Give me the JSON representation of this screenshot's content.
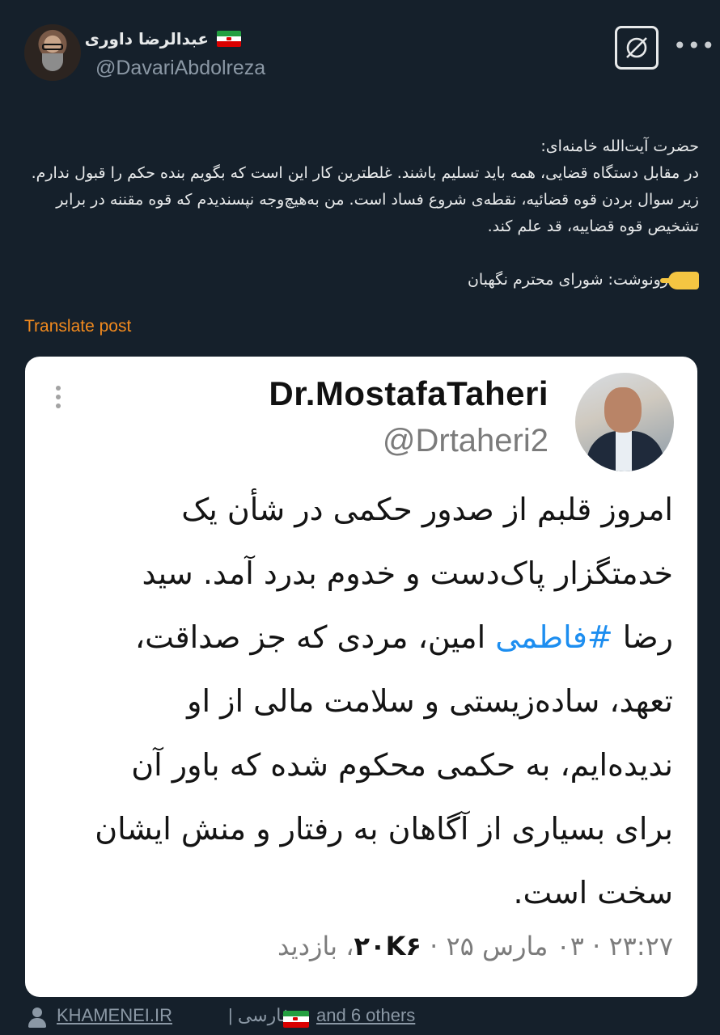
{
  "author": {
    "name": "عبدالرضا داوری",
    "handle": "@DavariAbdolreza"
  },
  "post": {
    "text": "حضرت آیت‌الله خامنه‌ای:\nدر مقابل دستگاه قضایی، همه باید تسلیم باشند. غلطترین کار این است که بگویم بنده حکم را قبول ندارم. زیر سوال بردن قوه قضائیه، نقطه‌ی شروع فساد است. من به‌هیچ‌وجه نپسندیدم که قوه مقننه در برابر تشخیص قوه قضاییه، قد علم کند.\n\n",
    "cc_line": "رونوشت: شورای محترم نگهبان",
    "translate_label": "Translate post"
  },
  "quoted_image": {
    "name": "Dr.MostafaTaheri",
    "handle": "@Drtaheri2",
    "body_before": "امروز قلبم از صدور حکمی در شأن یک خدمتگزار پاک‌دست و خدوم بدرد آمد. سید رضا ",
    "hashtag": "#فاطمی",
    "body_after": " امین، مردی که جز صداقت، تعهد، ساده‌زیستی و سلامت مالی از او ندیده‌ایم، به حکمی محکوم شده که باور آن برای بسیاری از آگاهان به رفتار و منش ایشان سخت است.",
    "meta_time": "۲۳:۲۷ · ۰۳ مارس ۲۵ · ",
    "meta_views_count": "۲۰K۶",
    "meta_views_label": "، بازدید"
  },
  "footer": {
    "source": "KHAMENEI.IR",
    "separator_lang": "| فارسی",
    "others": "and 6 others"
  },
  "icons": {
    "flag": "iran-flag-icon",
    "grok": "grok-icon",
    "more": "more-icon",
    "pointing": "backhand-index-pointing-left-icon",
    "person": "person-icon"
  },
  "colors": {
    "background": "#15202b",
    "accent_translate": "#f28a1e",
    "hashtag": "#1d8ef0",
    "muted": "#8b98a5"
  }
}
